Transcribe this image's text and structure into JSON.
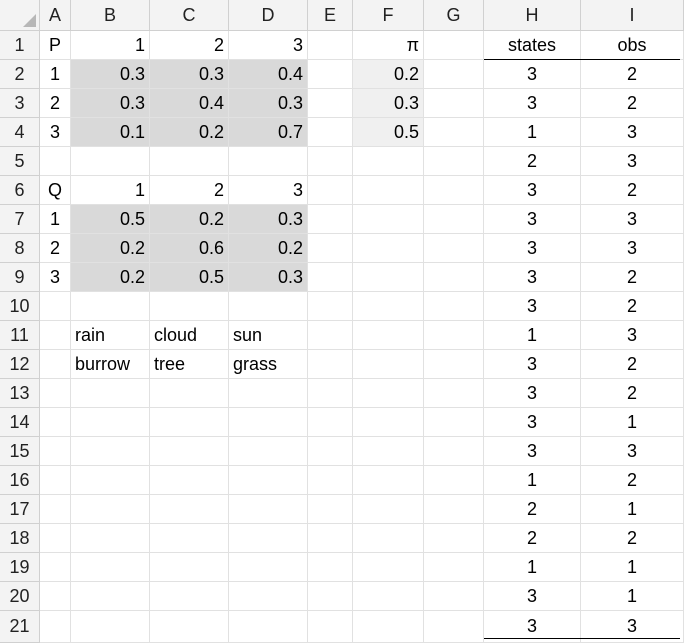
{
  "columns": [
    "A",
    "B",
    "C",
    "D",
    "E",
    "F",
    "G",
    "H",
    "I"
  ],
  "rows": [
    "1",
    "2",
    "3",
    "4",
    "5",
    "6",
    "7",
    "8",
    "9",
    "10",
    "11",
    "12",
    "13",
    "14",
    "15",
    "16",
    "17",
    "18",
    "19",
    "20",
    "21"
  ],
  "P": {
    "label": "P",
    "header": [
      "1",
      "2",
      "3"
    ],
    "row_labels": [
      "1",
      "2",
      "3"
    ],
    "values": [
      [
        "0.3",
        "0.3",
        "0.4"
      ],
      [
        "0.3",
        "0.4",
        "0.3"
      ],
      [
        "0.1",
        "0.2",
        "0.7"
      ]
    ]
  },
  "pi": {
    "label": "π",
    "values": [
      "0.2",
      "0.3",
      "0.5"
    ]
  },
  "Q": {
    "label": "Q",
    "header": [
      "1",
      "2",
      "3"
    ],
    "row_labels": [
      "1",
      "2",
      "3"
    ],
    "values": [
      [
        "0.5",
        "0.2",
        "0.3"
      ],
      [
        "0.2",
        "0.6",
        "0.2"
      ],
      [
        "0.2",
        "0.5",
        "0.3"
      ]
    ]
  },
  "names": {
    "states": [
      "rain",
      "cloud",
      "sun"
    ],
    "observations": [
      "burrow",
      "tree",
      "grass"
    ]
  },
  "table": {
    "headers": [
      "states",
      "obs"
    ],
    "states": [
      "3",
      "3",
      "1",
      "2",
      "3",
      "3",
      "3",
      "3",
      "3",
      "1",
      "3",
      "3",
      "3",
      "3",
      "1",
      "2",
      "2",
      "1",
      "3",
      "3"
    ],
    "obs": [
      "2",
      "2",
      "3",
      "3",
      "2",
      "3",
      "3",
      "2",
      "2",
      "3",
      "2",
      "2",
      "1",
      "3",
      "2",
      "1",
      "2",
      "1",
      "1",
      "3"
    ]
  }
}
